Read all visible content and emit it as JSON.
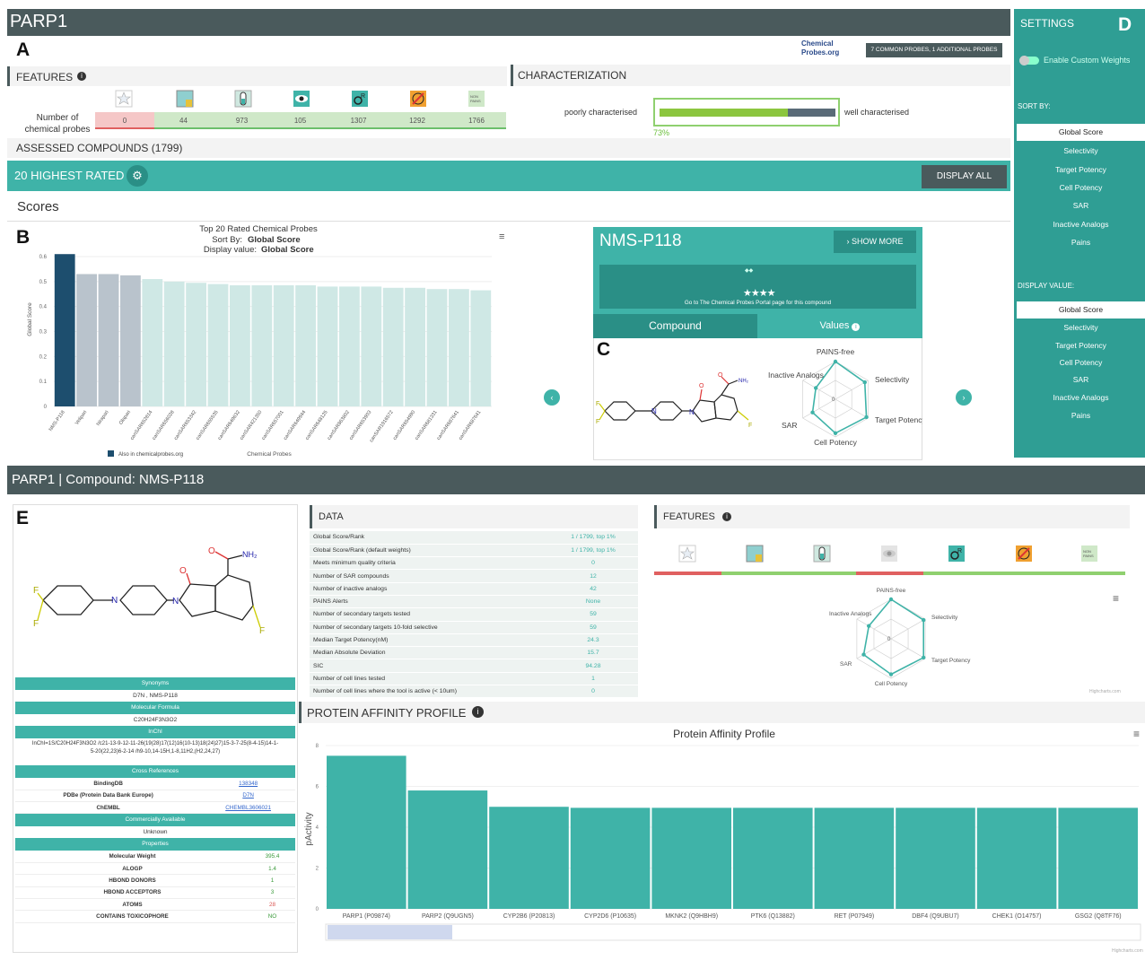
{
  "top": {
    "title": "PARP1",
    "panel_a": "A",
    "cp_logo": "Chemical Probes.org",
    "probes_badge": "7 COMMON PROBES, 1 ADDITIONAL PROBES",
    "features_header": "FEATURES",
    "num_probes_label": "Number of chemical probes",
    "feature_counts": [
      "0",
      "44",
      "973",
      "105",
      "1307",
      "1292",
      "1766"
    ],
    "char_header": "CHARACTERIZATION",
    "poorly": "poorly characterised",
    "well": "well characterised",
    "char_pct": "73%",
    "char_value": 0.73,
    "assessed": "ASSESSED COMPOUNDS (1799)",
    "highest": "20 HIGHEST RATED",
    "display_all": "DISPLAY ALL",
    "scores": "Scores",
    "panel_b": "B",
    "panel_c": "C",
    "panel_d": "D"
  },
  "chart1": {
    "title": "Top 20 Rated Chemical Probes",
    "sort_label": "Sort By:",
    "sort_value": "Global Score",
    "display_label": "Display value:",
    "display_value": "Global Score",
    "ylabel": "Global Score",
    "xlabel": "Chemical Probes",
    "legend": "Also in chemicalprobes.org"
  },
  "compound_card": {
    "name": "NMS-P118",
    "show_more": "SHOW MORE",
    "portal_text": "Go to The Chemical Probes Portal page for this compound",
    "tab_compound": "Compound",
    "tab_values": "Values",
    "radar": [
      "PAINS-free",
      "Selectivity",
      "Target Potency",
      "Cell Potency",
      "SAR",
      "Inactive Analogs"
    ]
  },
  "settings": {
    "title": "SETTINGS",
    "toggle": "Enable Custom Weights",
    "sort_by": "SORT BY:",
    "display_value": "DISPLAY VALUE:",
    "sort_items": [
      "Global Score",
      "Selectivity",
      "Target Potency",
      "Cell Potency",
      "SAR",
      "Inactive Analogs",
      "Pains"
    ],
    "display_items": [
      "Global Score",
      "Selectivity",
      "Target Potency",
      "Cell Potency",
      "SAR",
      "Inactive Analogs",
      "Pains"
    ]
  },
  "bottom": {
    "title": "PARP1 | Compound: NMS-P118",
    "panel_e": "E",
    "data_header": "DATA",
    "features_header": "FEATURES",
    "pap_header": "PROTEIN AFFINITY PROFILE",
    "pap_title": "Protein Affinity Profile",
    "pap_ylabel": "pActivity",
    "highcharts": "Highcharts.com",
    "data_rows": [
      {
        "label": "Global Score/Rank",
        "value": "1 / 1799, top 1%"
      },
      {
        "label": "Global Score/Rank (default weights)",
        "value": "1 / 1799, top 1%"
      },
      {
        "label": "Meets minimum quality criteria",
        "value": "0"
      },
      {
        "label": "Number of SAR compounds",
        "value": "12"
      },
      {
        "label": "Number of inactive analogs",
        "value": "42"
      },
      {
        "label": "PAINS Alerts",
        "value": "None"
      },
      {
        "label": "Number of secondary targets tested",
        "value": "59"
      },
      {
        "label": "Number of secondary targets 10-fold selective",
        "value": "59"
      },
      {
        "label": "Median Target Potency(nM)",
        "value": "24.3"
      },
      {
        "label": "Median Absolute Deviation",
        "value": "15.7"
      },
      {
        "label": "SIC",
        "value": "94.28"
      },
      {
        "label": "Number of cell lines tested",
        "value": "1"
      },
      {
        "label": "Number of cell lines where the tool is active (< 10um)",
        "value": "0"
      }
    ],
    "synonyms_h": "Synonyms",
    "synonyms": "D7N , NMS-P118",
    "formula_h": "Molecular Formula",
    "formula": "C20H24F3N3O2",
    "inchi_h": "InChI",
    "inchi": "InChI=1S/C20H24F3N3O2 /c21-13-9-12-11-26(19(28)17(12)16(10-13)18(24)27)15-3-7-25(8-4-15)14-1-5-20(22,23)6-2-14 /h9-10,14-15H,1-8,11H2,(H2,24,27)",
    "xref_h": "Cross References",
    "xrefs": [
      {
        "k": "BindingDB",
        "v": "138348"
      },
      {
        "k": "PDBe (Protein Data Bank Europe)",
        "v": "D7N"
      },
      {
        "k": "ChEMBL",
        "v": "CHEMBL3606021"
      }
    ],
    "commercial_h": "Commercially Available",
    "commercial": "Unknown",
    "props_h": "Properties",
    "props": [
      {
        "k": "Molecular Weight",
        "v": "395.4",
        "c": "#3a9a3a"
      },
      {
        "k": "ALOGP",
        "v": "1.4",
        "c": "#3a9a3a"
      },
      {
        "k": "HBOND DONORS",
        "v": "1",
        "c": "#3a9a3a"
      },
      {
        "k": "HBOND ACCEPTORS",
        "v": "3",
        "c": "#3a9a3a"
      },
      {
        "k": "ATOMS",
        "v": "28",
        "c": "#d9534f"
      },
      {
        "k": "CONTAINS TOXICOPHORE",
        "v": "NO",
        "c": "#3a9a3a"
      }
    ]
  },
  "chart_data": [
    {
      "type": "bar",
      "title": "Top 20 Rated Chemical Probes",
      "xlabel": "Chemical Probes",
      "ylabel": "Global Score",
      "ylim": [
        0,
        0.6
      ],
      "categories": [
        "NMS-P118",
        "Veliparib",
        "Niraparib",
        "Olaparib",
        "canSAR652814",
        "canSAR656028",
        "canSAR653342",
        "canSAR655535",
        "canSAR649632",
        "canSAR421350",
        "canSAR657001",
        "canSAR649944",
        "canSAR648125",
        "canSAR863802",
        "canSAR653903",
        "canSAR1916572",
        "canSAR654990",
        "canSAR681331",
        "canSAR687641",
        "canSAR687641b"
      ],
      "values": [
        0.61,
        0.53,
        0.53,
        0.525,
        0.51,
        0.5,
        0.495,
        0.49,
        0.485,
        0.485,
        0.485,
        0.485,
        0.48,
        0.48,
        0.48,
        0.475,
        0.475,
        0.47,
        0.47,
        0.465
      ],
      "colors": [
        "#1d4e6e",
        "#b9c3cc",
        "#b9c3cc",
        "#b9c3cc",
        "#cfe8e5",
        "#cfe8e5",
        "#cfe8e5",
        "#cfe8e5",
        "#cfe8e5",
        "#cfe8e5",
        "#cfe8e5",
        "#cfe8e5",
        "#cfe8e5",
        "#cfe8e5",
        "#cfe8e5",
        "#cfe8e5",
        "#cfe8e5",
        "#cfe8e5",
        "#cfe8e5",
        "#cfe8e5"
      ],
      "yticks": [
        "0",
        "0.1",
        "0.2",
        "0.3",
        "0.4",
        "0.5",
        "0.6"
      ]
    },
    {
      "type": "bar",
      "title": "Protein Affinity Profile",
      "ylabel": "pActivity",
      "ylim": [
        0,
        8
      ],
      "categories": [
        "PARP1 (P09874)",
        "PARP2 (Q9UGN5)",
        "CYP2B6 (P20813)",
        "CYP2D6 (P10635)",
        "MKNK2 (Q9HBH9)",
        "PTK6 (Q13882)",
        "RET (P07949)",
        "DBF4 (Q9UBU7)",
        "CHEK1 (O14757)",
        "GSG2 (Q8TF76)"
      ],
      "values": [
        7.5,
        5.8,
        5.0,
        4.95,
        4.95,
        4.95,
        4.95,
        4.95,
        4.95,
        4.95
      ],
      "yticks": [
        "0",
        "2",
        "4",
        "6",
        "8"
      ]
    }
  ]
}
